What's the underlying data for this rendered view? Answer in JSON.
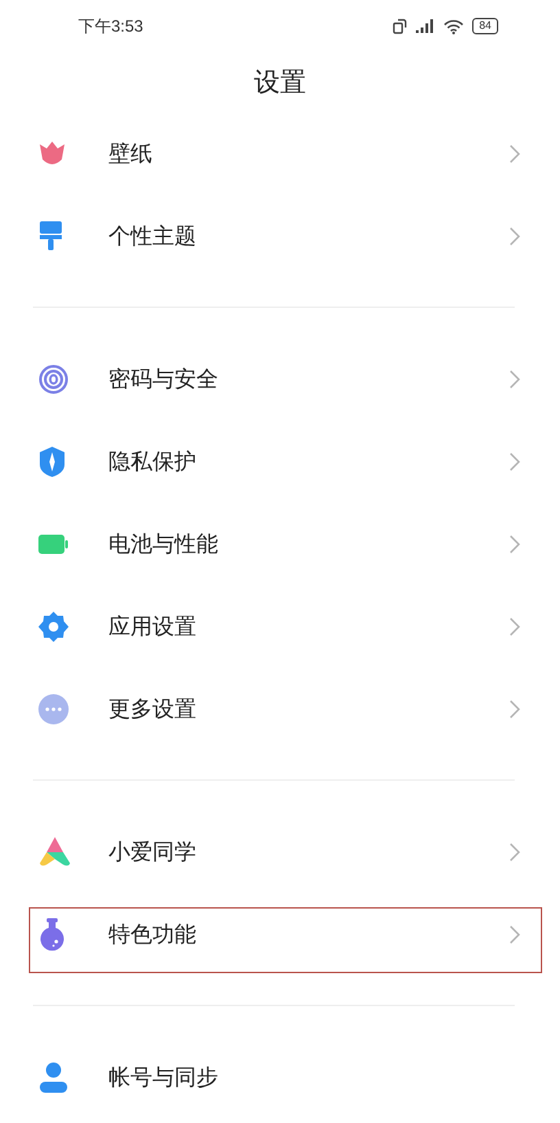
{
  "status_bar": {
    "time": "下午3:53",
    "battery": "84"
  },
  "title": "设置",
  "groups": [
    {
      "items": [
        {
          "label": "壁纸",
          "kind": "tulip",
          "chevron": true,
          "highlighted": false
        },
        {
          "label": "个性主题",
          "kind": "brush",
          "chevron": true,
          "highlighted": false
        }
      ]
    },
    {
      "items": [
        {
          "label": "密码与安全",
          "kind": "fingerprint",
          "chevron": true,
          "highlighted": false
        },
        {
          "label": "隐私保护",
          "kind": "shield",
          "chevron": true,
          "highlighted": false
        },
        {
          "label": "电池与性能",
          "kind": "battery",
          "chevron": true,
          "highlighted": false
        },
        {
          "label": "应用设置",
          "kind": "gear",
          "chevron": true,
          "highlighted": false
        },
        {
          "label": "更多设置",
          "kind": "dots",
          "chevron": true,
          "highlighted": false
        }
      ]
    },
    {
      "items": [
        {
          "label": "小爱同学",
          "kind": "triangle",
          "chevron": true,
          "highlighted": false
        },
        {
          "label": "特色功能",
          "kind": "flask",
          "chevron": true,
          "highlighted": true
        }
      ]
    },
    {
      "items": [
        {
          "label": "帐号与同步",
          "kind": "person",
          "chevron": false,
          "highlighted": false
        }
      ]
    }
  ]
}
